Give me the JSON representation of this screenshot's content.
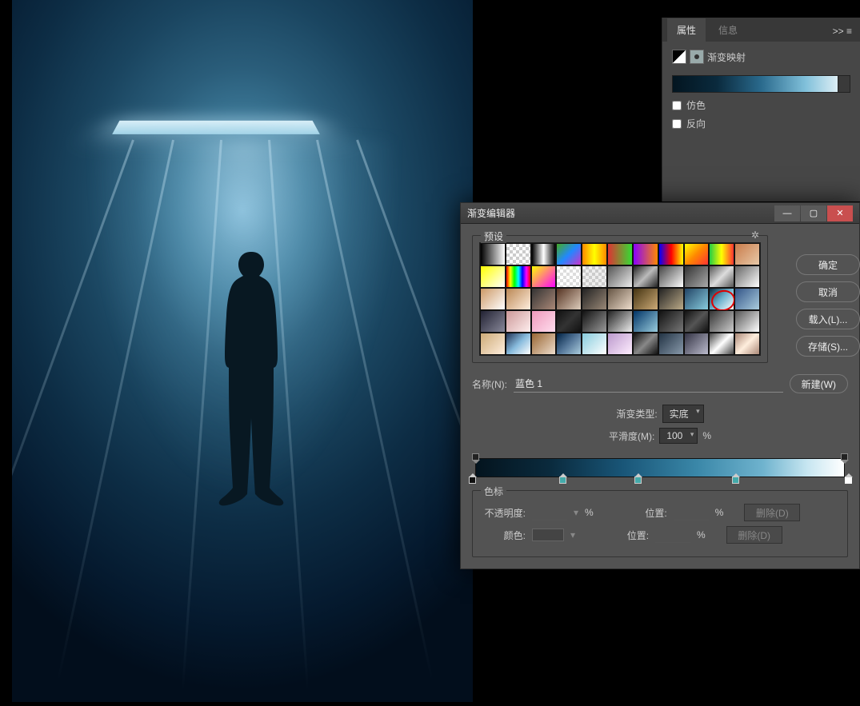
{
  "properties": {
    "tabs": [
      "属性",
      "信息"
    ],
    "active_tab": 0,
    "more": ">>",
    "menu": "≡",
    "adjustment_type": "渐变映射",
    "dither": "仿色",
    "reverse": "反向"
  },
  "dialog": {
    "title": "渐变编辑器",
    "presets_label": "预设",
    "settings_icon": "✲",
    "buttons": {
      "ok": "确定",
      "cancel": "取消",
      "load": "载入(L)...",
      "save": "存储(S)...",
      "new": "新建(W)",
      "delete": "删除(D)"
    },
    "name_label": "名称(N):",
    "name_value": "蓝色 1",
    "gradient_type_label": "渐变类型:",
    "gradient_type_value": "实底",
    "smoothness_label": "平滑度(M):",
    "smoothness_value": "100",
    "pct": "%",
    "stops_label": "色标",
    "opacity_label": "不透明度:",
    "position_label": "位置:",
    "color_label": "颜色:",
    "selected_swatch_index": 31,
    "swatches": [
      {
        "bg": "linear-gradient(90deg,#000,#fff)"
      },
      {
        "bg": "repeating-conic-gradient(#ccc 0 25%,#fff 0 50%) 0 0/8px 8px"
      },
      {
        "bg": "linear-gradient(90deg,#000,#fff,#000)"
      },
      {
        "bg": "linear-gradient(135deg,#4a2,#28f,#c3c)"
      },
      {
        "bg": "linear-gradient(90deg,#f80,#ff0,#f80)"
      },
      {
        "bg": "linear-gradient(90deg,#d33,#3d3)"
      },
      {
        "bg": "linear-gradient(90deg,#80f,#f80)"
      },
      {
        "bg": "linear-gradient(90deg,#00f,#f00,#ff0)"
      },
      {
        "bg": "linear-gradient(135deg,#ff0,#f80,#f33)"
      },
      {
        "bg": "linear-gradient(90deg,#2c4,#ff0,#f33)"
      },
      {
        "bg": "linear-gradient(135deg,#c97b4a,#e8c9a8)"
      },
      {
        "bg": "linear-gradient(135deg,#ff0,#fff)"
      },
      {
        "bg": "linear-gradient(90deg,#f00,#ff0,#0f0,#0ff,#00f,#f0f,#f00)"
      },
      {
        "bg": "linear-gradient(135deg,#ff0,#f0f)"
      },
      {
        "bg": "repeating-conic-gradient(#ddd 0 25%,#fff 0 50%) 0 0/8px 8px"
      },
      {
        "bg": "repeating-conic-gradient(#ccc 0 25%,#eee 0 50%) 0 0/8px 8px"
      },
      {
        "bg": "linear-gradient(135deg,#555,#eee)"
      },
      {
        "bg": "linear-gradient(135deg,#222,#bbb,#222)"
      },
      {
        "bg": "linear-gradient(135deg,#444,#fff)"
      },
      {
        "bg": "linear-gradient(135deg,#333,#aaa)"
      },
      {
        "bg": "linear-gradient(135deg,#555,#ddd,#555)"
      },
      {
        "bg": "linear-gradient(135deg,#666,#fff)"
      },
      {
        "bg": "linear-gradient(135deg,#c96,#fff)"
      },
      {
        "bg": "linear-gradient(135deg,#b85,#fed)"
      },
      {
        "bg": "linear-gradient(135deg,#333,#a87)"
      },
      {
        "bg": "linear-gradient(135deg,#532,#dcb)"
      },
      {
        "bg": "linear-gradient(135deg,#222,#987)"
      },
      {
        "bg": "linear-gradient(135deg,#654,#edc)"
      },
      {
        "bg": "linear-gradient(135deg,#431,#ca7)"
      },
      {
        "bg": "linear-gradient(135deg,#222,#ba8)"
      },
      {
        "bg": "linear-gradient(135deg,#246,#8cd)"
      },
      {
        "bg": "linear-gradient(135deg,#0a2a3d,#6fb3ce,#fff)"
      },
      {
        "bg": "linear-gradient(135deg,#358,#acd)"
      },
      {
        "bg": "linear-gradient(135deg,#223,#889)"
      },
      {
        "bg": "linear-gradient(135deg,#c99,#fee)"
      },
      {
        "bg": "linear-gradient(135deg,#e9b,#fde)"
      },
      {
        "bg": "linear-gradient(135deg,#111,#333,#111)"
      },
      {
        "bg": "linear-gradient(135deg,#111,#999)"
      },
      {
        "bg": "linear-gradient(135deg,#222,#eee)"
      },
      {
        "bg": "linear-gradient(135deg,#036,#9cd)"
      },
      {
        "bg": "linear-gradient(135deg,#111,#777)"
      },
      {
        "bg": "linear-gradient(135deg,#111,#555,#111)"
      },
      {
        "bg": "linear-gradient(135deg,#333,#ccc)"
      },
      {
        "bg": "linear-gradient(135deg,#555,#fff)"
      },
      {
        "bg": "linear-gradient(135deg,#ca7,#fed)"
      },
      {
        "bg": "linear-gradient(135deg,#235,#8bd,#fff)"
      },
      {
        "bg": "linear-gradient(135deg,#963,#edc)"
      },
      {
        "bg": "linear-gradient(135deg,#024,#579,#acd)"
      },
      {
        "bg": "linear-gradient(135deg,#8cd,#fff)"
      },
      {
        "bg": "linear-gradient(135deg,#b9c,#fef)"
      },
      {
        "bg": "linear-gradient(135deg,#111,#888,#111)"
      },
      {
        "bg": "linear-gradient(135deg,#234,#89a)"
      },
      {
        "bg": "linear-gradient(135deg,#334,#bbc)"
      },
      {
        "bg": "linear-gradient(135deg,#444,#fff,#444)"
      },
      {
        "bg": "linear-gradient(135deg,#a87,#fed,#a87)"
      }
    ],
    "color_stops_pos": [
      0,
      24,
      44,
      70,
      100
    ]
  }
}
